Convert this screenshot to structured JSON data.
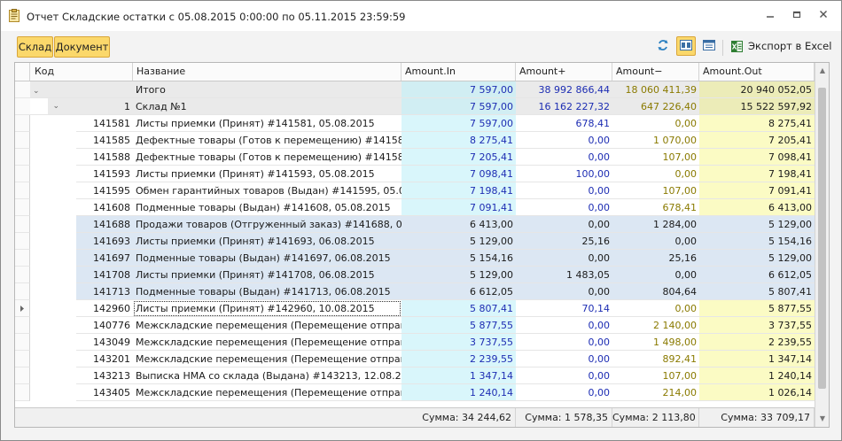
{
  "window": {
    "title": "Отчет Складские остатки с 05.08.2015 0:00:00 по 05.11.2015 23:59:59"
  },
  "toolbar": {
    "sklad_label": "Склад",
    "document_label": "Документ",
    "export_label": "Экспорт в Excel"
  },
  "columns": {
    "kod": "Код",
    "name": "Название",
    "amount_in": "Amount.In",
    "amount_plus": "Amount+",
    "amount_minus": "Amount−",
    "amount_out": "Amount.Out"
  },
  "total_row": {
    "name": "Итого",
    "amount_in": "7 597,00",
    "amount_plus": "38 992 866,44",
    "amount_minus": "18 060 411,39",
    "amount_out": "20 940 052,05"
  },
  "group_row": {
    "kod": "1",
    "name": "Склад №1",
    "amount_in": "7 597,00",
    "amount_plus": "16 162 227,32",
    "amount_minus": "647 226,40",
    "amount_out": "15 522 597,92"
  },
  "rows": [
    {
      "kod": "141581",
      "name": "Листы приемки (Принят) #141581, 05.08.2015",
      "in": "7 597,00",
      "plus": "678,41",
      "minus": "0,00",
      "out": "8 275,41"
    },
    {
      "kod": "141585",
      "name": "Дефектные товары (Готов к перемещению) #141585, ...",
      "in": "8 275,41",
      "plus": "0,00",
      "minus": "1 070,00",
      "out": "7 205,41"
    },
    {
      "kod": "141588",
      "name": "Дефектные товары (Готов к перемещению) #141588, ...",
      "in": "7 205,41",
      "plus": "0,00",
      "minus": "107,00",
      "out": "7 098,41"
    },
    {
      "kod": "141593",
      "name": "Листы приемки (Принят) #141593, 05.08.2015",
      "in": "7 098,41",
      "plus": "100,00",
      "minus": "0,00",
      "out": "7 198,41"
    },
    {
      "kod": "141595",
      "name": "Обмен гарантийных товаров (Выдан) #141595, 05.08.2...",
      "in": "7 198,41",
      "plus": "0,00",
      "minus": "107,00",
      "out": "7 091,41"
    },
    {
      "kod": "141608",
      "name": "Подменные товары (Выдан) #141608, 05.08.2015",
      "in": "7 091,41",
      "plus": "0,00",
      "minus": "678,41",
      "out": "6 413,00"
    },
    {
      "kod": "141688",
      "name": "Продажи товаров (Отгруженный заказ) #141688, 06.0...",
      "in": "6 413,00",
      "plus": "0,00",
      "minus": "1 284,00",
      "out": "5 129,00"
    },
    {
      "kod": "141693",
      "name": "Листы приемки (Принят) #141693, 06.08.2015",
      "in": "5 129,00",
      "plus": "25,16",
      "minus": "0,00",
      "out": "5 154,16"
    },
    {
      "kod": "141697",
      "name": "Подменные товары (Выдан) #141697, 06.08.2015",
      "in": "5 154,16",
      "plus": "0,00",
      "minus": "25,16",
      "out": "5 129,00"
    },
    {
      "kod": "141708",
      "name": "Листы приемки (Принят) #141708, 06.08.2015",
      "in": "5 129,00",
      "plus": "1 483,05",
      "minus": "0,00",
      "out": "6 612,05"
    },
    {
      "kod": "141713",
      "name": "Подменные товары (Выдан) #141713, 06.08.2015",
      "in": "6 612,05",
      "plus": "0,00",
      "minus": "804,64",
      "out": "5 807,41"
    },
    {
      "kod": "142960",
      "name": "Листы приемки (Принят) #142960, 10.08.2015",
      "in": "5 807,41",
      "plus": "70,14",
      "minus": "0,00",
      "out": "5 877,55"
    },
    {
      "kod": "140776",
      "name": "Межскладские перемещения (Перемещение отправлен...",
      "in": "5 877,55",
      "plus": "0,00",
      "minus": "2 140,00",
      "out": "3 737,55"
    },
    {
      "kod": "143049",
      "name": "Межскладские перемещения (Перемещение отправлен...",
      "in": "3 737,55",
      "plus": "0,00",
      "minus": "1 498,00",
      "out": "2 239,55"
    },
    {
      "kod": "143201",
      "name": "Межскладские перемещения (Перемещение отправлен...",
      "in": "2 239,55",
      "plus": "0,00",
      "minus": "892,41",
      "out": "1 347,14"
    },
    {
      "kod": "143213",
      "name": "Выписка НМА со склада (Выдана) #143213, 12.08.2015",
      "in": "1 347,14",
      "plus": "0,00",
      "minus": "107,00",
      "out": "1 240,14"
    },
    {
      "kod": "143405",
      "name": "Межскладские перемещения (Перемещение отправлен...",
      "in": "1 240,14",
      "plus": "0,00",
      "minus": "214,00",
      "out": "1 026,14"
    }
  ],
  "footer": {
    "sum_in": "Сумма: 34 244,62",
    "sum_plus": "Сумма: 1 578,35",
    "sum_minus": "Сумма: 2 113,80",
    "sum_out": "Сумма: 33 709,17"
  },
  "colors": {
    "accent": "#fbd86b",
    "in_column": "#d9f6fb",
    "out_column": "#fbfbc4",
    "selected_rows": "#dce7f3",
    "blue_text": "#1d2db3",
    "olive_text": "#8a7a00"
  }
}
